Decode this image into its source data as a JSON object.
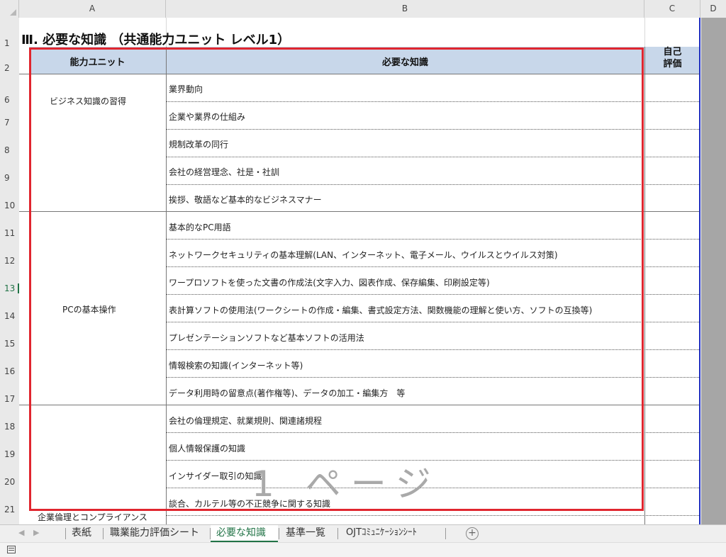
{
  "columns": [
    "A",
    "B",
    "C",
    "D"
  ],
  "rows": [
    "1",
    "2",
    "6",
    "7",
    "8",
    "9",
    "10",
    "11",
    "12",
    "13",
    "14",
    "15",
    "16",
    "17",
    "18",
    "19",
    "20",
    "21"
  ],
  "active_row": "13",
  "sheet": {
    "title": "Ⅲ. 必要な知識 （共通能力ユニット レベル1）",
    "header": {
      "unit": "能力ユニット",
      "knowledge": "必要な知識",
      "self_eval_line1": "自己",
      "self_eval_line2": "評価"
    },
    "units": [
      {
        "name": "ビジネス知識の習得",
        "items": [
          "業界動向",
          "企業や業界の仕組み",
          "規制改革の同行",
          "会社の経営理念、社是・社訓",
          "挨拶、敬語など基本的なビジネスマナー"
        ]
      },
      {
        "name": "PCの基本操作",
        "items": [
          "基本的なPC用語",
          "ネットワークセキュリティの基本理解(LAN、インターネット、電子メール、ウイルスとウイルス対策)",
          "ワープロソフトを使った文書の作成法(文字入力、図表作成、保存編集、印刷設定等)",
          "表計算ソフトの使用法(ワークシートの作成・編集、書式設定方法、関数機能の理解と使い方、ソフトの互換等)",
          "プレゼンテーションソフトなど基本ソフトの活用法",
          "情報検索の知識(インターネット等)",
          "データ利用時の留意点(著作権等)、データの加工・編集方　等"
        ]
      },
      {
        "name": "企業倫理とコンプライアンス",
        "items": [
          "会社の倫理規定、就業規則、関連諸規程",
          "個人情報保護の知識",
          "インサイダー取引の知識",
          "談合、カルテル等の不正競争に関する知識"
        ]
      }
    ],
    "watermark": "1 ページ"
  },
  "tabs": [
    "表紙",
    "職業能力評価シート",
    "必要な知識",
    "基準一覧",
    "OJTｺﾐｭﾆｹｰｼｮﾝｼｰﾄ"
  ],
  "active_tab": "必要な知識",
  "add_tab_label": "+",
  "colors": {
    "accent": "#217346",
    "header_fill": "#c8d7ea",
    "highlight_box": "#e0262f",
    "page_break": "#1f2fbf"
  }
}
